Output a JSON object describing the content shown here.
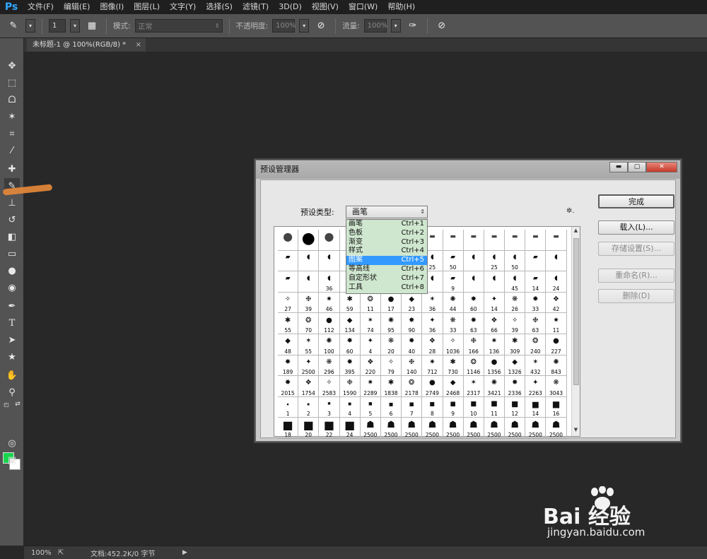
{
  "app": {
    "logo": "Ps"
  },
  "menu": [
    "文件(F)",
    "编辑(E)",
    "图像(I)",
    "图层(L)",
    "文字(Y)",
    "选择(S)",
    "滤镜(T)",
    "3D(D)",
    "视图(V)",
    "窗口(W)",
    "帮助(H)"
  ],
  "options": {
    "brush_size": "1",
    "mode_label": "模式:",
    "mode_value": "正常",
    "opacity_label": "不透明度:",
    "opacity_value": "100%",
    "flow_label": "流量:",
    "flow_value": "100%"
  },
  "document": {
    "tab_title": "未标题-1 @ 100%(RGB/8) *",
    "tab_close": "×"
  },
  "status": {
    "zoom": "100%",
    "doc_info": "文档:452.2K/0 字节",
    "arrow": "▶"
  },
  "colors": {
    "foreground": "#19d44e",
    "background": "#ffffff",
    "accent": "#3399ff"
  },
  "dialog": {
    "title": "预设管理器",
    "preset_type_label": "预设类型:",
    "preset_type_value": "画笔",
    "gear": "✲.",
    "type_options": [
      {
        "label": "画笔",
        "shortcut": "Ctrl+1"
      },
      {
        "label": "色板",
        "shortcut": "Ctrl+2"
      },
      {
        "label": "渐变",
        "shortcut": "Ctrl+3"
      },
      {
        "label": "样式",
        "shortcut": "Ctrl+4"
      },
      {
        "label": "图案",
        "shortcut": "Ctrl+5",
        "selected": true
      },
      {
        "label": "等高线",
        "shortcut": "Ctrl+6"
      },
      {
        "label": "自定形状",
        "shortcut": "Ctrl+7"
      },
      {
        "label": "工具",
        "shortcut": "Ctrl+8"
      }
    ],
    "buttons": {
      "done": "完成",
      "load": "载入(L)...",
      "save": "存储设置(S)...",
      "rename": "重命名(R)...",
      "delete": "删除(D)"
    },
    "brush_rows": [
      [
        "",
        "",
        "",
        "",
        "",
        "",
        "",
        "",
        "",
        "",
        "",
        "",
        "",
        ""
      ],
      [
        "",
        "",
        "",
        "",
        "",
        "",
        "",
        "25",
        "50",
        "",
        "25",
        "50",
        "",
        ""
      ],
      [
        "",
        "",
        "36",
        "",
        "",
        "",
        "",
        "",
        "9",
        "",
        "",
        "45",
        "14",
        "24"
      ],
      [
        "27",
        "39",
        "46",
        "59",
        "11",
        "17",
        "23",
        "36",
        "44",
        "60",
        "14",
        "26",
        "33",
        "42"
      ],
      [
        "55",
        "70",
        "112",
        "134",
        "74",
        "95",
        "90",
        "36",
        "33",
        "63",
        "66",
        "39",
        "63",
        "11"
      ],
      [
        "48",
        "55",
        "100",
        "60",
        "4",
        "20",
        "40",
        "28",
        "1036",
        "166",
        "136",
        "309",
        "240",
        "227"
      ],
      [
        "189",
        "2500",
        "296",
        "395",
        "220",
        "79",
        "140",
        "712",
        "730",
        "1146",
        "1356",
        "1326",
        "432",
        "843"
      ],
      [
        "2015",
        "1754",
        "2583",
        "1590",
        "2289",
        "1838",
        "2178",
        "2749",
        "2468",
        "2317",
        "3421",
        "2336",
        "2263",
        "3043"
      ],
      [
        "1",
        "2",
        "3",
        "4",
        "5",
        "6",
        "7",
        "8",
        "9",
        "10",
        "11",
        "12",
        "14",
        "16"
      ],
      [
        "18",
        "20",
        "22",
        "24",
        "2500",
        "2500",
        "2500",
        "2500",
        "2500",
        "2500",
        "2500",
        "2500",
        "2500",
        "2500"
      ]
    ]
  },
  "watermark": {
    "brand": "Bai 经验",
    "url": "jingyan.baidu.com"
  }
}
